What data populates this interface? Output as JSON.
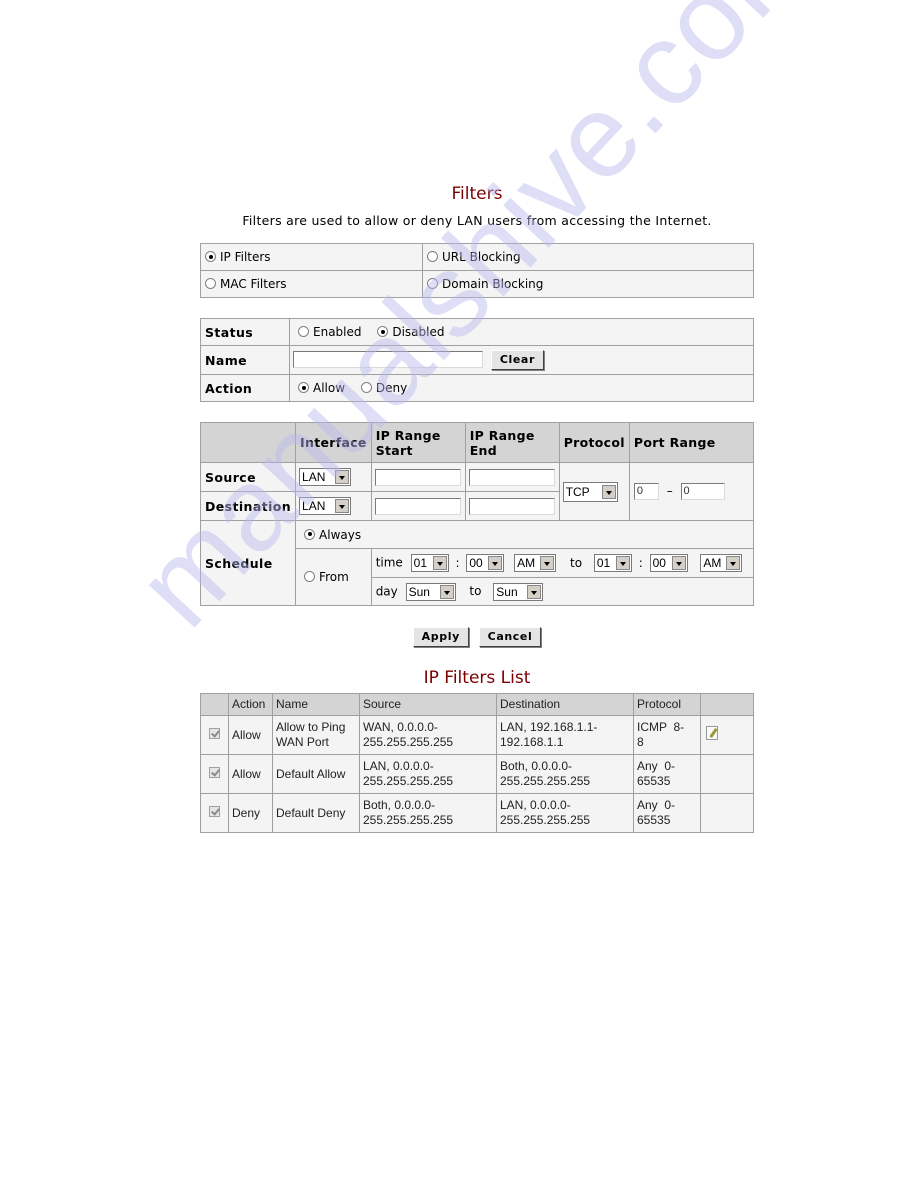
{
  "header": {
    "title": "Filters",
    "subtitle": "Filters are used to allow or deny LAN users from accessing the Internet."
  },
  "filter_types": [
    {
      "label": "IP Filters",
      "selected": true
    },
    {
      "label": "URL Blocking",
      "selected": false
    },
    {
      "label": "MAC Filters",
      "selected": false
    },
    {
      "label": "Domain Blocking",
      "selected": false
    }
  ],
  "form": {
    "status_label": "Status",
    "status_options": [
      {
        "label": "Enabled",
        "selected": false
      },
      {
        "label": "Disabled",
        "selected": true
      }
    ],
    "name_label": "Name",
    "name_value": "",
    "clear_label": "Clear",
    "action_label": "Action",
    "action_options": [
      {
        "label": "Allow",
        "selected": true
      },
      {
        "label": "Deny",
        "selected": false
      }
    ]
  },
  "rules": {
    "headers": {
      "interface": "Interface",
      "ip_start": "IP Range Start",
      "ip_start_l1": "IP Range",
      "ip_start_l2": "Start",
      "ip_end_l1": "IP Range",
      "ip_end_l2": "End",
      "protocol": "Protocol",
      "port_range": "Port Range"
    },
    "source": {
      "label": "Source",
      "interface": "LAN",
      "ip_start": "",
      "ip_end": ""
    },
    "destination": {
      "label": "Destination",
      "interface": "LAN",
      "ip_start": "",
      "ip_end": ""
    },
    "protocol": "TCP",
    "port_start": "0",
    "port_sep": "–",
    "port_end": "0"
  },
  "schedule": {
    "label": "Schedule",
    "always_label": "Always",
    "always_selected": true,
    "from_label": "From",
    "from_selected": false,
    "time_label": "time",
    "to_label": "to",
    "colon": ":",
    "day_label": "day",
    "time_from": {
      "hour": "01",
      "minute": "00",
      "ampm": "AM"
    },
    "time_to": {
      "hour": "01",
      "minute": "00",
      "ampm": "AM"
    },
    "day_from": "Sun",
    "day_to": "Sun"
  },
  "buttons": {
    "apply": "Apply",
    "cancel": "Cancel"
  },
  "list": {
    "title": "IP Filters List",
    "columns": [
      "",
      "Action",
      "Name",
      "Source",
      "Destination",
      "Protocol",
      ""
    ],
    "rows": [
      {
        "checked": true,
        "action": "Allow",
        "name_l1": "Allow to Ping",
        "name_l2": "WAN Port",
        "source_l1": "WAN, 0.0.0.0-",
        "source_l2": "255.255.255.255",
        "dest_l1": "LAN, 192.168.1.1-",
        "dest_l2": "192.168.1.1",
        "proto_l1": "ICMP  8-",
        "proto_l2": "8",
        "editable": true
      },
      {
        "checked": true,
        "action": "Allow",
        "name_l1": "Default Allow",
        "name_l2": "",
        "source_l1": "LAN, 0.0.0.0-",
        "source_l2": "255.255.255.255",
        "dest_l1": "Both, 0.0.0.0-",
        "dest_l2": "255.255.255.255",
        "proto_l1": "Any  0-",
        "proto_l2": "65535",
        "editable": false
      },
      {
        "checked": true,
        "action": "Deny",
        "name_l1": "Default Deny",
        "name_l2": "",
        "source_l1": "Both, 0.0.0.0-",
        "source_l2": "255.255.255.255",
        "dest_l1": "LAN, 0.0.0.0-",
        "dest_l2": "255.255.255.255",
        "proto_l1": "Any  0-",
        "proto_l2": "65535",
        "editable": false
      }
    ]
  },
  "watermark": "manualshive.com",
  "colors": {
    "title": "#7a0000",
    "header_bg": "#d4d4d4",
    "cell_bg": "#f4f4f4",
    "border": "#a0a0a0",
    "watermark": "#b8b8ee"
  }
}
